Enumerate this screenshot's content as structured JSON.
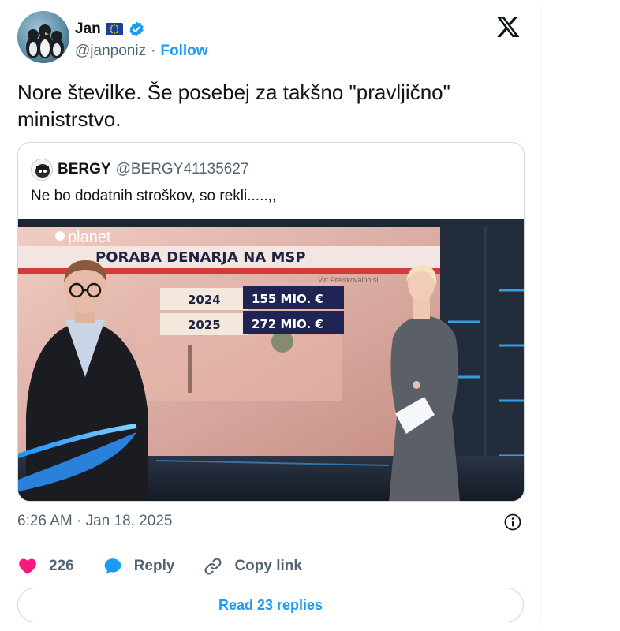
{
  "author": {
    "name": "Jan",
    "handle": "@janponiz",
    "follow_label": "Follow"
  },
  "tweet": {
    "text": "Nore številke. Še posebej za takšno \"pravljično\" ministrstvo.",
    "timestamp": "6:26 AM · Jan 18, 2025"
  },
  "quoted": {
    "name": "BERGY",
    "handle": "@BERGY41135627",
    "text": "Ne bo dodatnih stroškov, so rekli.....,,",
    "video": {
      "logo": "planet",
      "headline": "PORABA DENARJA NA MSP",
      "source": "Vir: Preiskovalno.si",
      "rows": [
        {
          "year": "2024",
          "amount": "155 MIO. €"
        },
        {
          "year": "2025",
          "amount": "272 MIO. €"
        }
      ]
    }
  },
  "actions": {
    "likes": "226",
    "reply_label": "Reply",
    "copy_label": "Copy link"
  },
  "read_replies_label": "Read 23 replies",
  "colors": {
    "accent": "#1d9bf0",
    "heart": "#f91880",
    "text": "#0f1419",
    "muted": "#536471"
  },
  "icons": [
    "eu-flag-icon",
    "verified-badge-icon",
    "x-logo-icon",
    "info-icon",
    "heart-icon",
    "reply-icon",
    "link-icon"
  ]
}
